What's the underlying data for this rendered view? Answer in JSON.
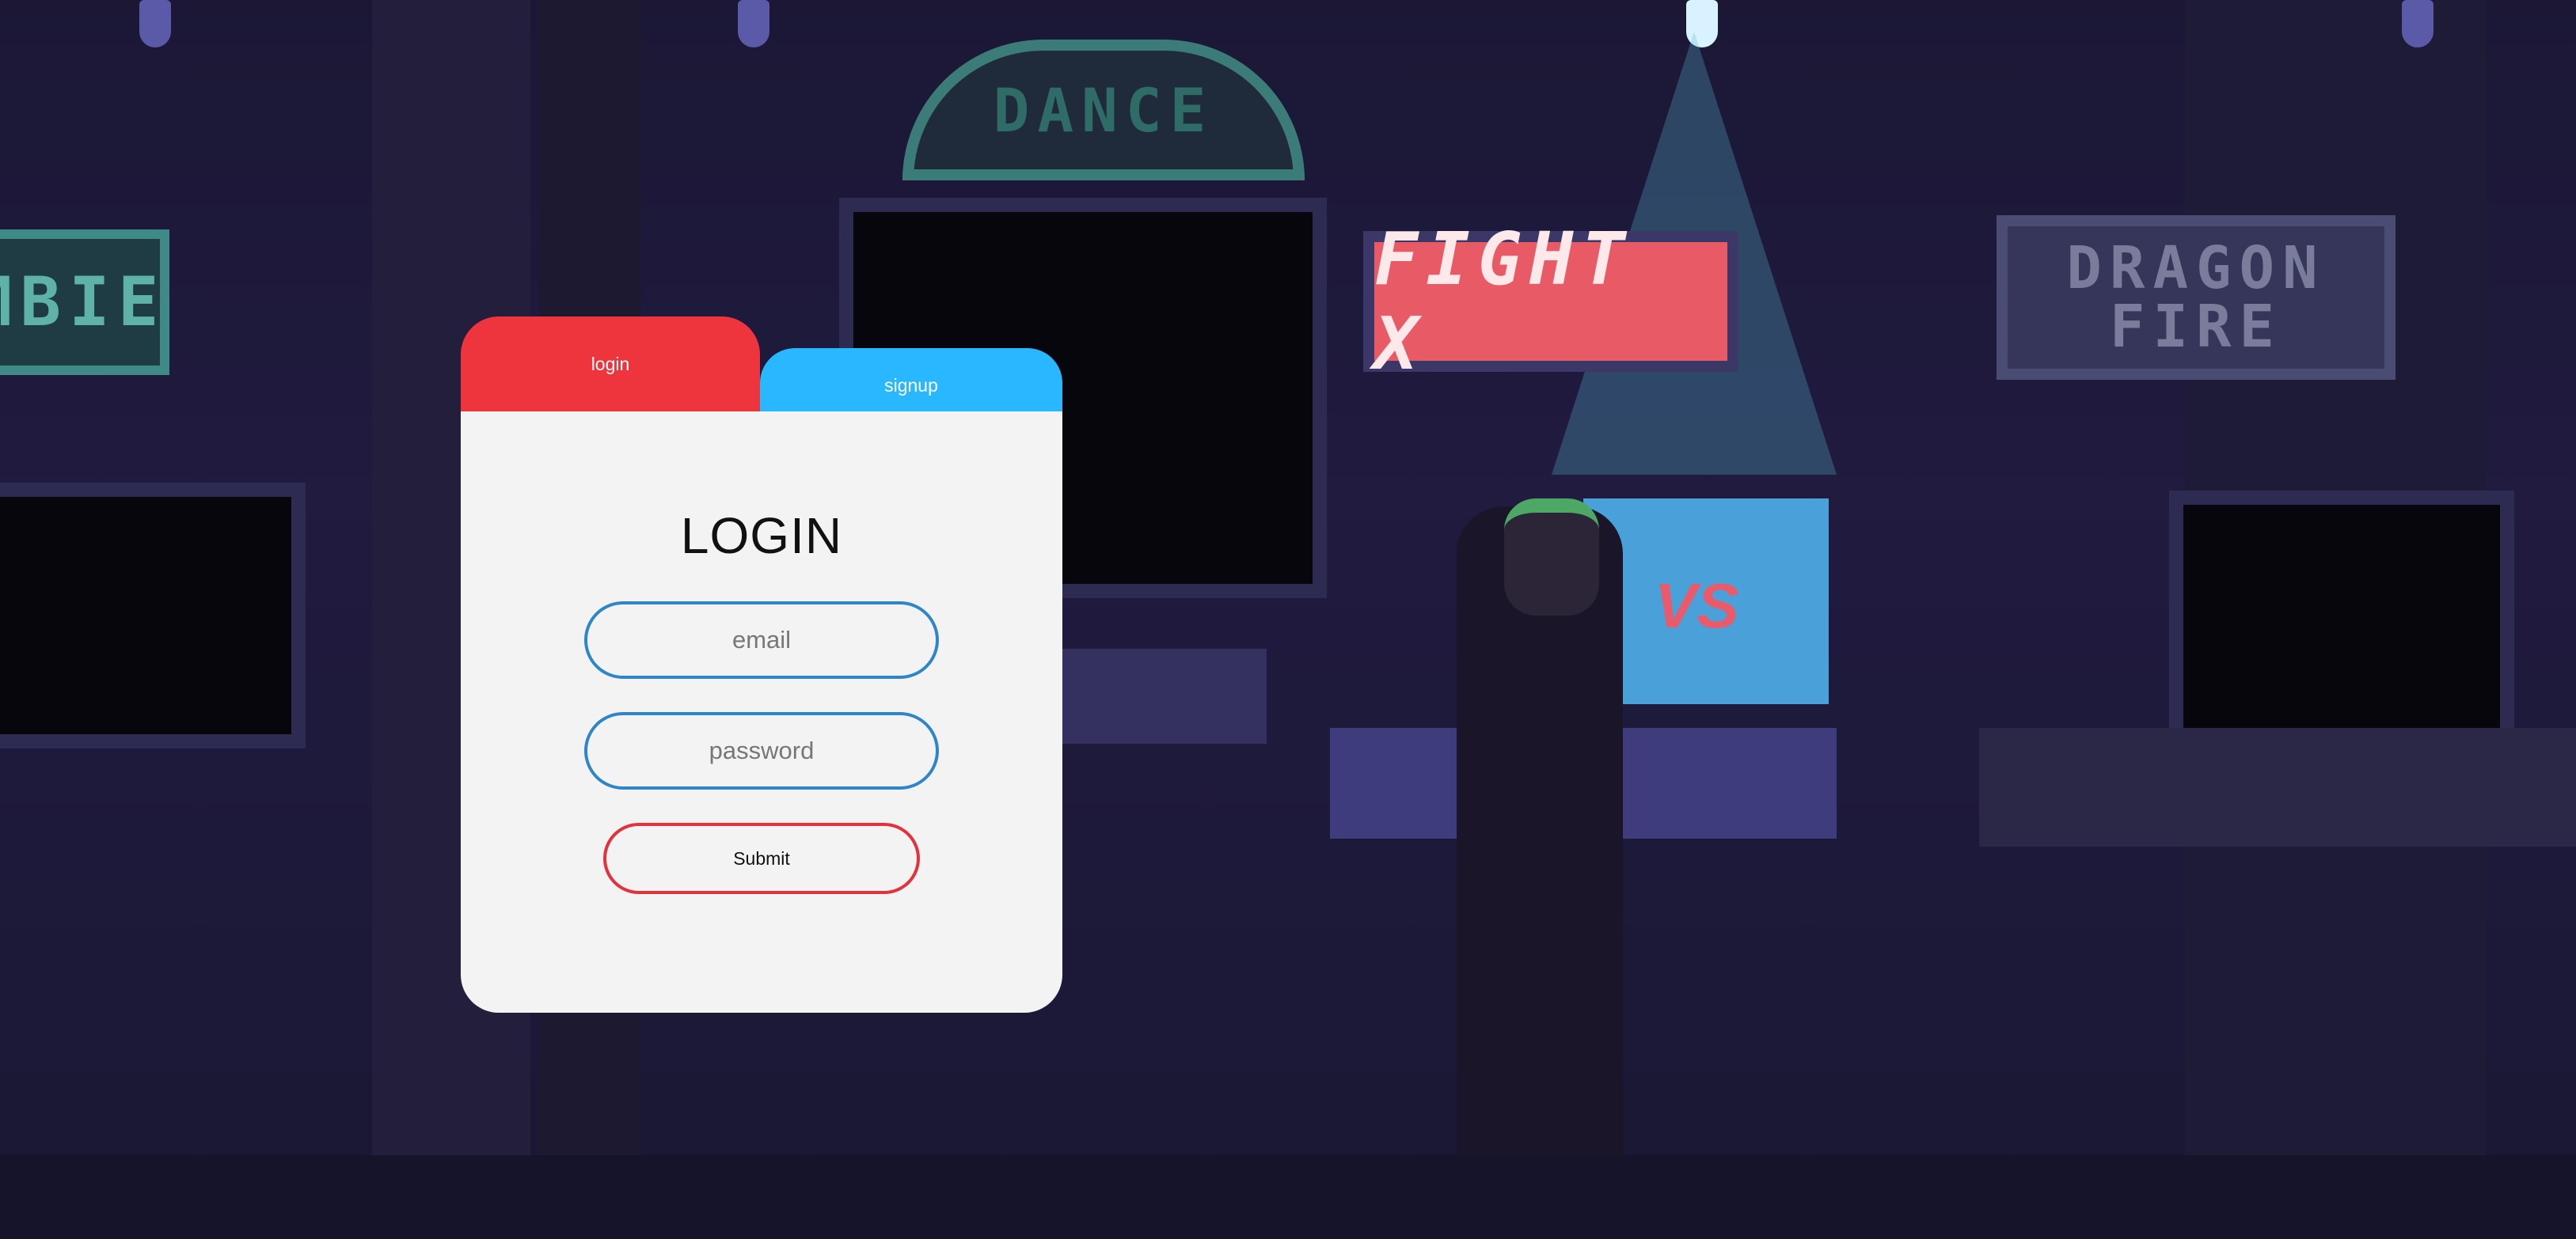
{
  "background": {
    "signs": {
      "fight": "FIGHT X",
      "dragon_line1": "DRAGON",
      "dragon_line2": "FIRE",
      "dance": "DANCE",
      "zombie": "MBIE"
    },
    "game_screen_text": "VS"
  },
  "tabs": {
    "login": "login",
    "signup": "signup"
  },
  "form": {
    "title": "LOGIN",
    "email_placeholder": "email",
    "password_placeholder": "password",
    "submit_label": "Submit"
  },
  "colors": {
    "login_tab": "#ee343c",
    "signup_tab": "#29b7ff",
    "panel": "#f3f3f3",
    "input_border": "#2e86c8",
    "submit_border": "#e2323c"
  }
}
